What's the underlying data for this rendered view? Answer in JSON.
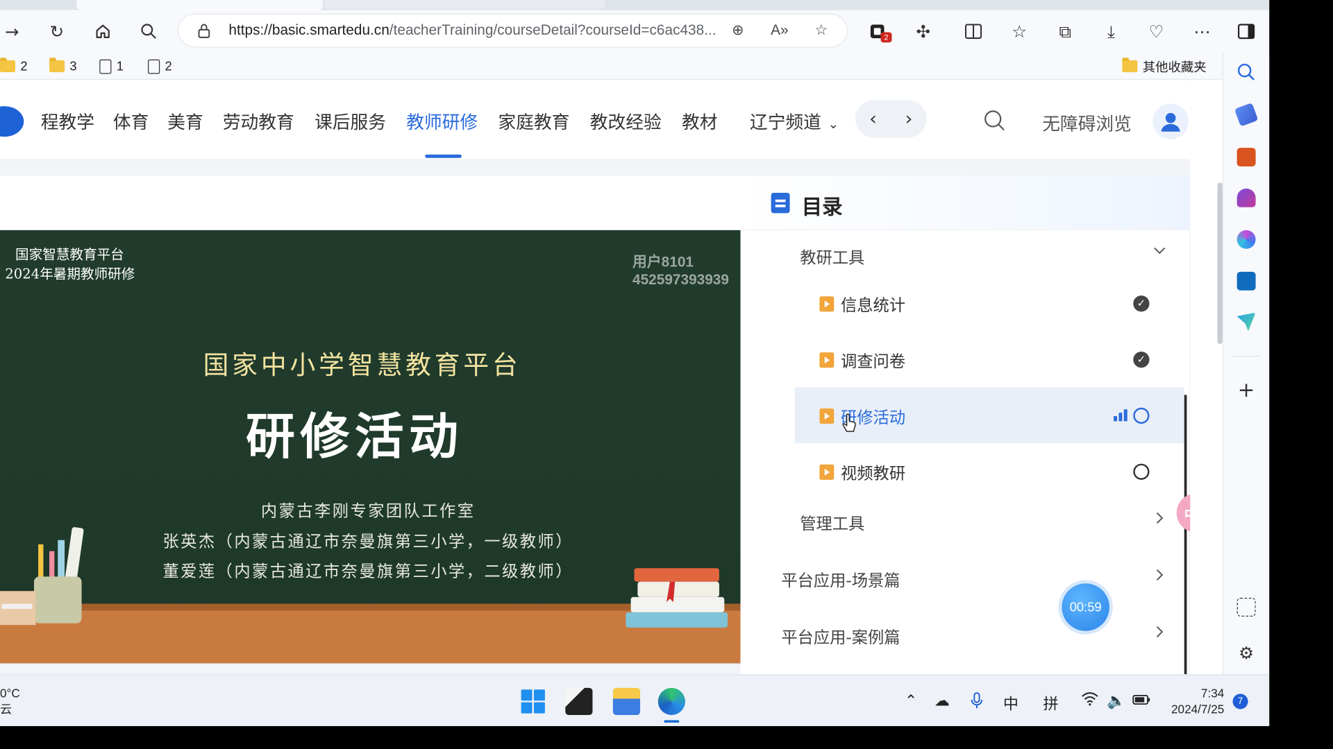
{
  "browser": {
    "url_domain": "https://basic.smartedu.cn",
    "url_path": "/teacherTraining/courseDetail?courseId=c6ac438...",
    "extension_badge": "2"
  },
  "bookmarks": [
    {
      "type": "folder",
      "label": "2"
    },
    {
      "type": "folder",
      "label": "3"
    },
    {
      "type": "page",
      "label": "1"
    },
    {
      "type": "page",
      "label": "2"
    }
  ],
  "bookmarks_other": "其他收藏夹",
  "site_nav": {
    "items": [
      "程教学",
      "体育",
      "美育",
      "劳动教育",
      "课后服务",
      "教师研修",
      "家庭教育",
      "教改经验",
      "教材"
    ],
    "active": "教师研修",
    "region": "辽宁频道",
    "accessibility": "无障碍浏览"
  },
  "video": {
    "top_line1": "国家智慧教育平台",
    "top_line2": "2024年暑期教师研修",
    "watermark_user": "用户8101",
    "watermark_id": "452597393939",
    "title": "国家中小学智慧教育平台",
    "big_title": "研修活动",
    "line1": "内蒙古李刚专家团队工作室",
    "line2": "张英杰（内蒙古通辽市奈曼旗第三小学，一级教师）",
    "line3": "董爱莲（内蒙古通辽市奈曼旗第三小学，二级教师）"
  },
  "catalog": {
    "title": "目录",
    "section1": "教研工具",
    "items": [
      {
        "label": "信息统计",
        "status": "done"
      },
      {
        "label": "调查问卷",
        "status": "done"
      },
      {
        "label": "研修活动",
        "status": "playing"
      },
      {
        "label": "视频教研",
        "status": "pending"
      }
    ],
    "section2": "管理工具",
    "section3": "平台应用-场景篇",
    "section4": "平台应用-案例篇"
  },
  "timer": "00:59",
  "translate_label": "中A",
  "taskbar": {
    "weather_temp": "0°C",
    "weather_desc": "云",
    "ime1": "中",
    "ime2": "拼",
    "time": "7:34",
    "date": "2024/7/25",
    "notifications": "7"
  },
  "colors": {
    "accent": "#2a6bdb",
    "board": "#213b2c",
    "title_gold": "#f4e4a0"
  }
}
